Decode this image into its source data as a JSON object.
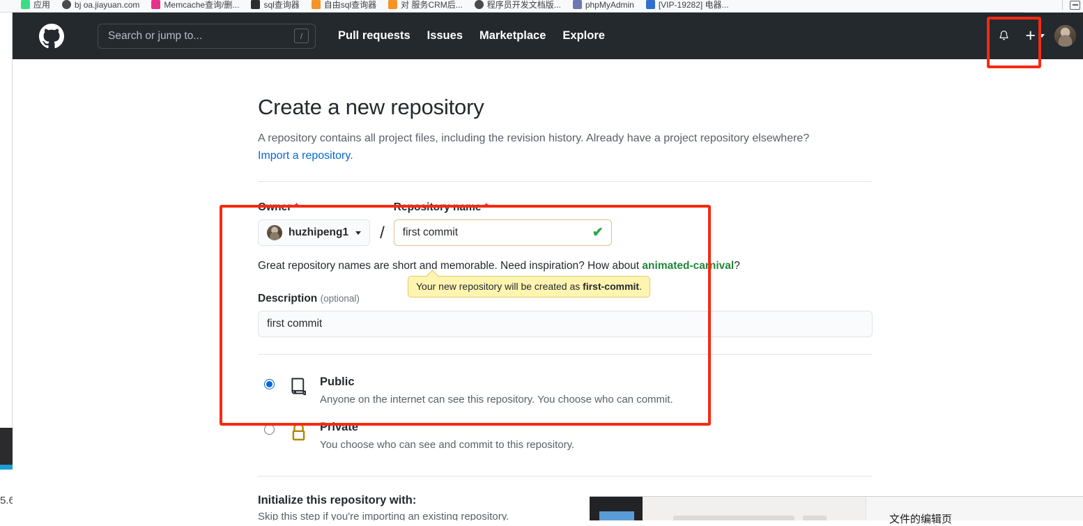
{
  "browser": {
    "bookmarks": [
      {
        "label": "应用",
        "favicon_color": "#3ddc84",
        "icon_name": "apps-grid-icon"
      },
      {
        "label": "bj oa.jiayuan.com",
        "favicon_color": "#4a4a4a",
        "icon_name": "shield-icon"
      },
      {
        "label": "Memcache查询/删...",
        "favicon_color": "#e8318a",
        "icon_name": "memcache-icon"
      },
      {
        "label": "sql查询器",
        "favicon_color": "#2d2d2d",
        "icon_name": "sql-icon"
      },
      {
        "label": "自由sql查询器",
        "favicon_color": "#f59324",
        "icon_name": "folder-icon"
      },
      {
        "label": "对  服务CRM后...",
        "favicon_color": "#f59324",
        "icon_name": "folder-icon"
      },
      {
        "label": "程序员开发文档版...",
        "favicon_color": "#4a4a4a",
        "icon_name": "shield-icon"
      },
      {
        "label": "phpMyAdmin",
        "favicon_color": "#6c78af",
        "icon_name": "phpmyadmin-icon"
      },
      {
        "label": "[VIP-19282] 电器...",
        "favicon_color": "#2f6fd0",
        "icon_name": "jira-icon"
      }
    ],
    "overflow_icon_name": "bookmark-overflow-icon",
    "window_icon_name": "browser-window-icon"
  },
  "header": {
    "logo_icon": "github-mark-icon",
    "search": {
      "placeholder": "Search or jump to...",
      "value": "",
      "shortcut_badge": "/"
    },
    "nav": [
      {
        "label": "Pull requests",
        "name": "nav-pull-requests"
      },
      {
        "label": "Issues",
        "name": "nav-issues"
      },
      {
        "label": "Marketplace",
        "name": "nav-marketplace"
      },
      {
        "label": "Explore",
        "name": "nav-explore"
      }
    ],
    "notifications_icon": "bell-icon",
    "create_new_icon": "plus-icon",
    "create_new_caret_icon": "chevron-down-icon",
    "avatar_name": "user-avatar"
  },
  "main": {
    "title": "Create a new repository",
    "subtitle": "A repository contains all project files, including the revision history. Already have a project repository elsewhere?",
    "import_link": "Import a repository.",
    "owner": {
      "label": "Owner",
      "required_mark": "*",
      "selected": "huzhipeng1",
      "caret_icon": "chevron-down-icon"
    },
    "separator": "/",
    "repository_name": {
      "label": "Repository name",
      "required_mark": "*",
      "value": "first commit",
      "placeholder": "",
      "valid_icon": "check-icon",
      "valid_glyph": "✔"
    },
    "tooltip": {
      "prefix": "Your new repository will be created as ",
      "slug": "first-commit",
      "suffix": "."
    },
    "hint": {
      "prefix": "Great repository names are ",
      "middle": "short and memorable. Need inspiration? How a",
      "tail_prefix": "bout ",
      "suggestion": "animated-carnival",
      "tail_suffix": "?"
    },
    "description": {
      "label": "Description",
      "optional": "(optional)",
      "value": "first commit",
      "placeholder": ""
    },
    "visibility": [
      {
        "name": "public",
        "title": "Public",
        "description": "Anyone on the internet can see this repository. You choose who can commit.",
        "icon_name": "repo-book-icon",
        "selected": true
      },
      {
        "name": "private",
        "title": "Private",
        "description": "You choose who can see and commit to this repository.",
        "icon_name": "lock-icon",
        "selected": false
      }
    ],
    "initialize": {
      "heading": "Initialize this repository with:",
      "subtext": "Skip this step if you're importing an existing repository."
    }
  },
  "overlay": {
    "left_sliver_text": "5.6",
    "right_text": "文件的编辑页"
  },
  "annotations": {
    "color": "#f52a12",
    "boxes": [
      {
        "name": "annotation-header-actions"
      },
      {
        "name": "annotation-repo-form"
      }
    ]
  }
}
